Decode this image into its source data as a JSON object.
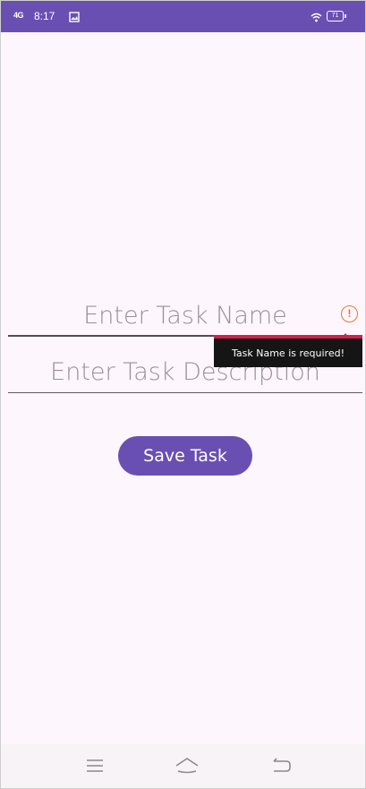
{
  "status_bar": {
    "signal": "4G",
    "time": "8:17",
    "battery_level": "71",
    "background_color": "#6a4fb3",
    "icons": [
      "signal-icon",
      "photo-app-icon",
      "wifi-icon",
      "battery-icon"
    ]
  },
  "form": {
    "task_name": {
      "placeholder": "Enter Task Name",
      "value": "",
      "error_text": "Task Name is required!",
      "error_icon": "error-exclamation-icon",
      "error_color": "#d31f4a"
    },
    "task_description": {
      "placeholder": "Enter Task Description",
      "value": ""
    },
    "save_button": {
      "label": "Save Task",
      "color": "#6a4fb3"
    }
  },
  "nav_bar": {
    "buttons": [
      "menu-icon",
      "home-icon",
      "back-icon"
    ]
  },
  "colors": {
    "background": "#fdf7fd",
    "accent": "#6a4fb3",
    "error": "#d31f4a",
    "warning_icon": "#e97532"
  }
}
